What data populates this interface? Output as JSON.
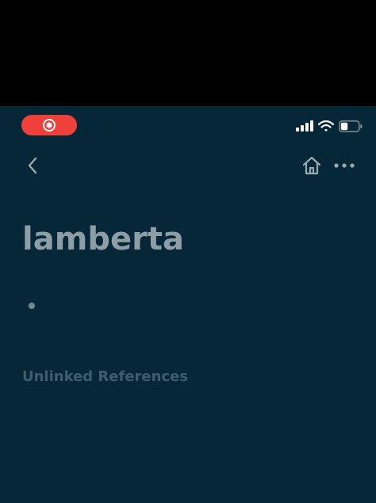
{
  "status_bar": {
    "recording_icon": "screen-recording-icon",
    "signal_icon": "cellular-signal-icon",
    "wifi_icon": "wifi-icon",
    "battery_icon": "battery-icon",
    "battery_level": 0.4
  },
  "nav": {
    "back_icon": "chevron-left-icon",
    "home_icon": "home-icon",
    "more_icon": "more-horizontal-icon"
  },
  "page": {
    "title": "lamberta",
    "unlinked_references_label": "Unlinked References"
  },
  "colors": {
    "background": "#052738",
    "title": "#8e9ea6",
    "muted_heading": "#3f5d69",
    "icon": "#9aaab2",
    "recording": "#f0403a"
  }
}
